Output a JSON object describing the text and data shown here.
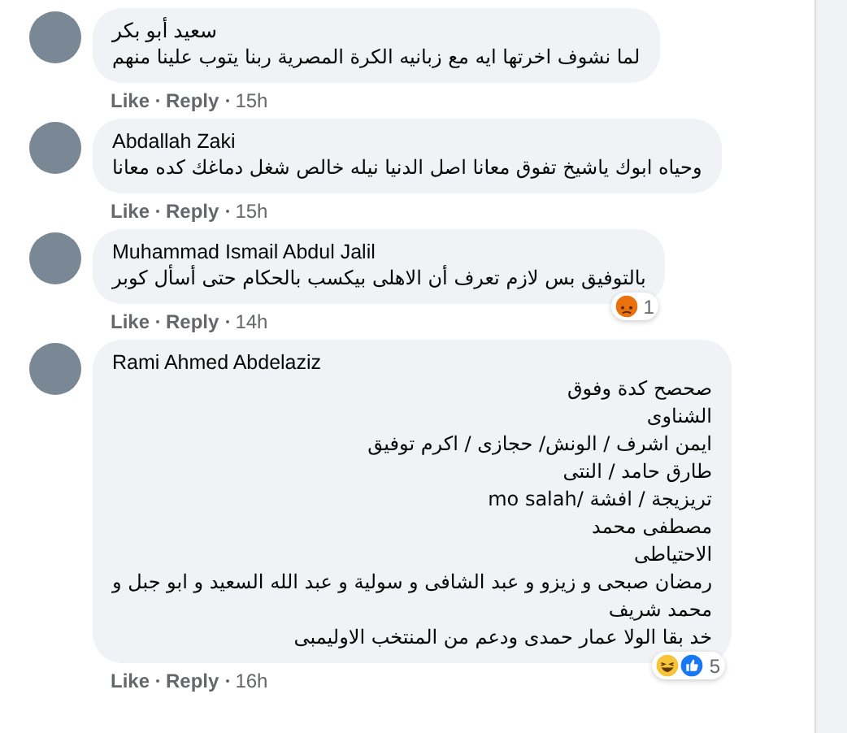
{
  "comments": [
    {
      "author": "سعيد أبو بكر",
      "lines": [
        "لما نشوف اخرتها ايه مع زبانيه الكرة المصرية ربنا يتوب علينا منهم"
      ],
      "like_label": "Like",
      "reply_label": "Reply",
      "time": "15h"
    },
    {
      "author": "Abdallah Zaki",
      "lines": [
        "وحياه ابوك ياشيخ تفوق معانا اصل الدنيا نيله خالص شغل دماغك كده معانا"
      ],
      "like_label": "Like",
      "reply_label": "Reply",
      "time": "15h"
    },
    {
      "author": "Muhammad Ismail Abdul Jalil",
      "lines": [
        "بالتوفيق بس لازم تعرف أن الاهلى بيكسب بالحكام حتى أسأل كوبر"
      ],
      "reactions": {
        "icons": [
          {
            "kind": "angry"
          }
        ],
        "count": "1"
      },
      "like_label": "Like",
      "reply_label": "Reply",
      "time": "14h"
    },
    {
      "author": "Rami Ahmed Abdelaziz",
      "lines": [
        "صحصح كدة وفوق",
        "الشناوى",
        "ايمن اشرف / الونش/ حجازى / اكرم توفيق",
        "طارق حامد / النتى",
        "تريزيجة / افشة /mo salah",
        "مصطفى محمد",
        "الاحتياطى",
        "رمضان صبحى و زيزو و عبد الشافى و سولية و عبد الله السعيد و ابو جبل و",
        "محمد شريف",
        "خد بقا الولا عمار حمدى ودعم من المنتخب الاوليمبى"
      ],
      "reactions": {
        "icons": [
          {
            "kind": "haha"
          },
          {
            "kind": "like"
          }
        ],
        "count": "5"
      },
      "like_label": "Like",
      "reply_label": "Reply",
      "time": "16h"
    }
  ]
}
